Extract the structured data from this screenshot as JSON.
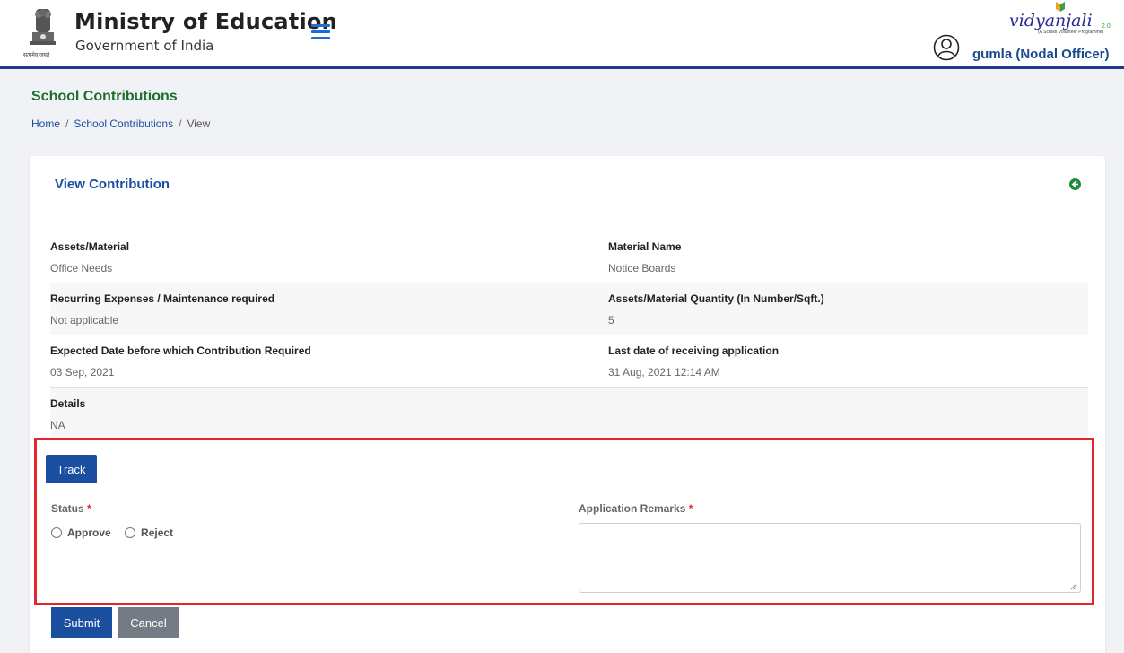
{
  "header": {
    "ministry_title": "Ministry of Education",
    "ministry_sub": "Government of India",
    "emblem_caption": "सत्यमेव जयते",
    "logo_text": "vidyanjali",
    "logo_tagline": "(A School Volunteer Programme)",
    "logo_version": "2.0",
    "user_name": "gumla (Nodal Officer)"
  },
  "page": {
    "title": "School Contributions",
    "breadcrumb": [
      "Home",
      "School Contributions",
      "View"
    ]
  },
  "card": {
    "title": "View Contribution",
    "details": [
      [
        {
          "label": "Assets/Material",
          "value": "Office Needs"
        },
        {
          "label": "Material Name",
          "value": "Notice Boards"
        }
      ],
      [
        {
          "label": "Recurring Expenses / Maintenance required",
          "value": "Not applicable"
        },
        {
          "label": "Assets/Material Quantity (In Number/Sqft.)",
          "value": "5"
        }
      ],
      [
        {
          "label": "Expected Date before which Contribution Required",
          "value": "03 Sep, 2021"
        },
        {
          "label": "Last date of receiving application",
          "value": "31 Aug, 2021 12:14 AM"
        }
      ],
      [
        {
          "label": "Details",
          "value": "NA"
        }
      ]
    ]
  },
  "form": {
    "track_label": "Track",
    "status_label": "Status",
    "required_mark": "*",
    "status_options": [
      "Approve",
      "Reject"
    ],
    "remarks_label": "Application Remarks",
    "remarks_value": "",
    "submit_label": "Submit",
    "cancel_label": "Cancel"
  },
  "colors": {
    "brand_blue": "#1a4fa0",
    "heading_green": "#1b6e2e",
    "highlight_red": "#e3262e"
  }
}
